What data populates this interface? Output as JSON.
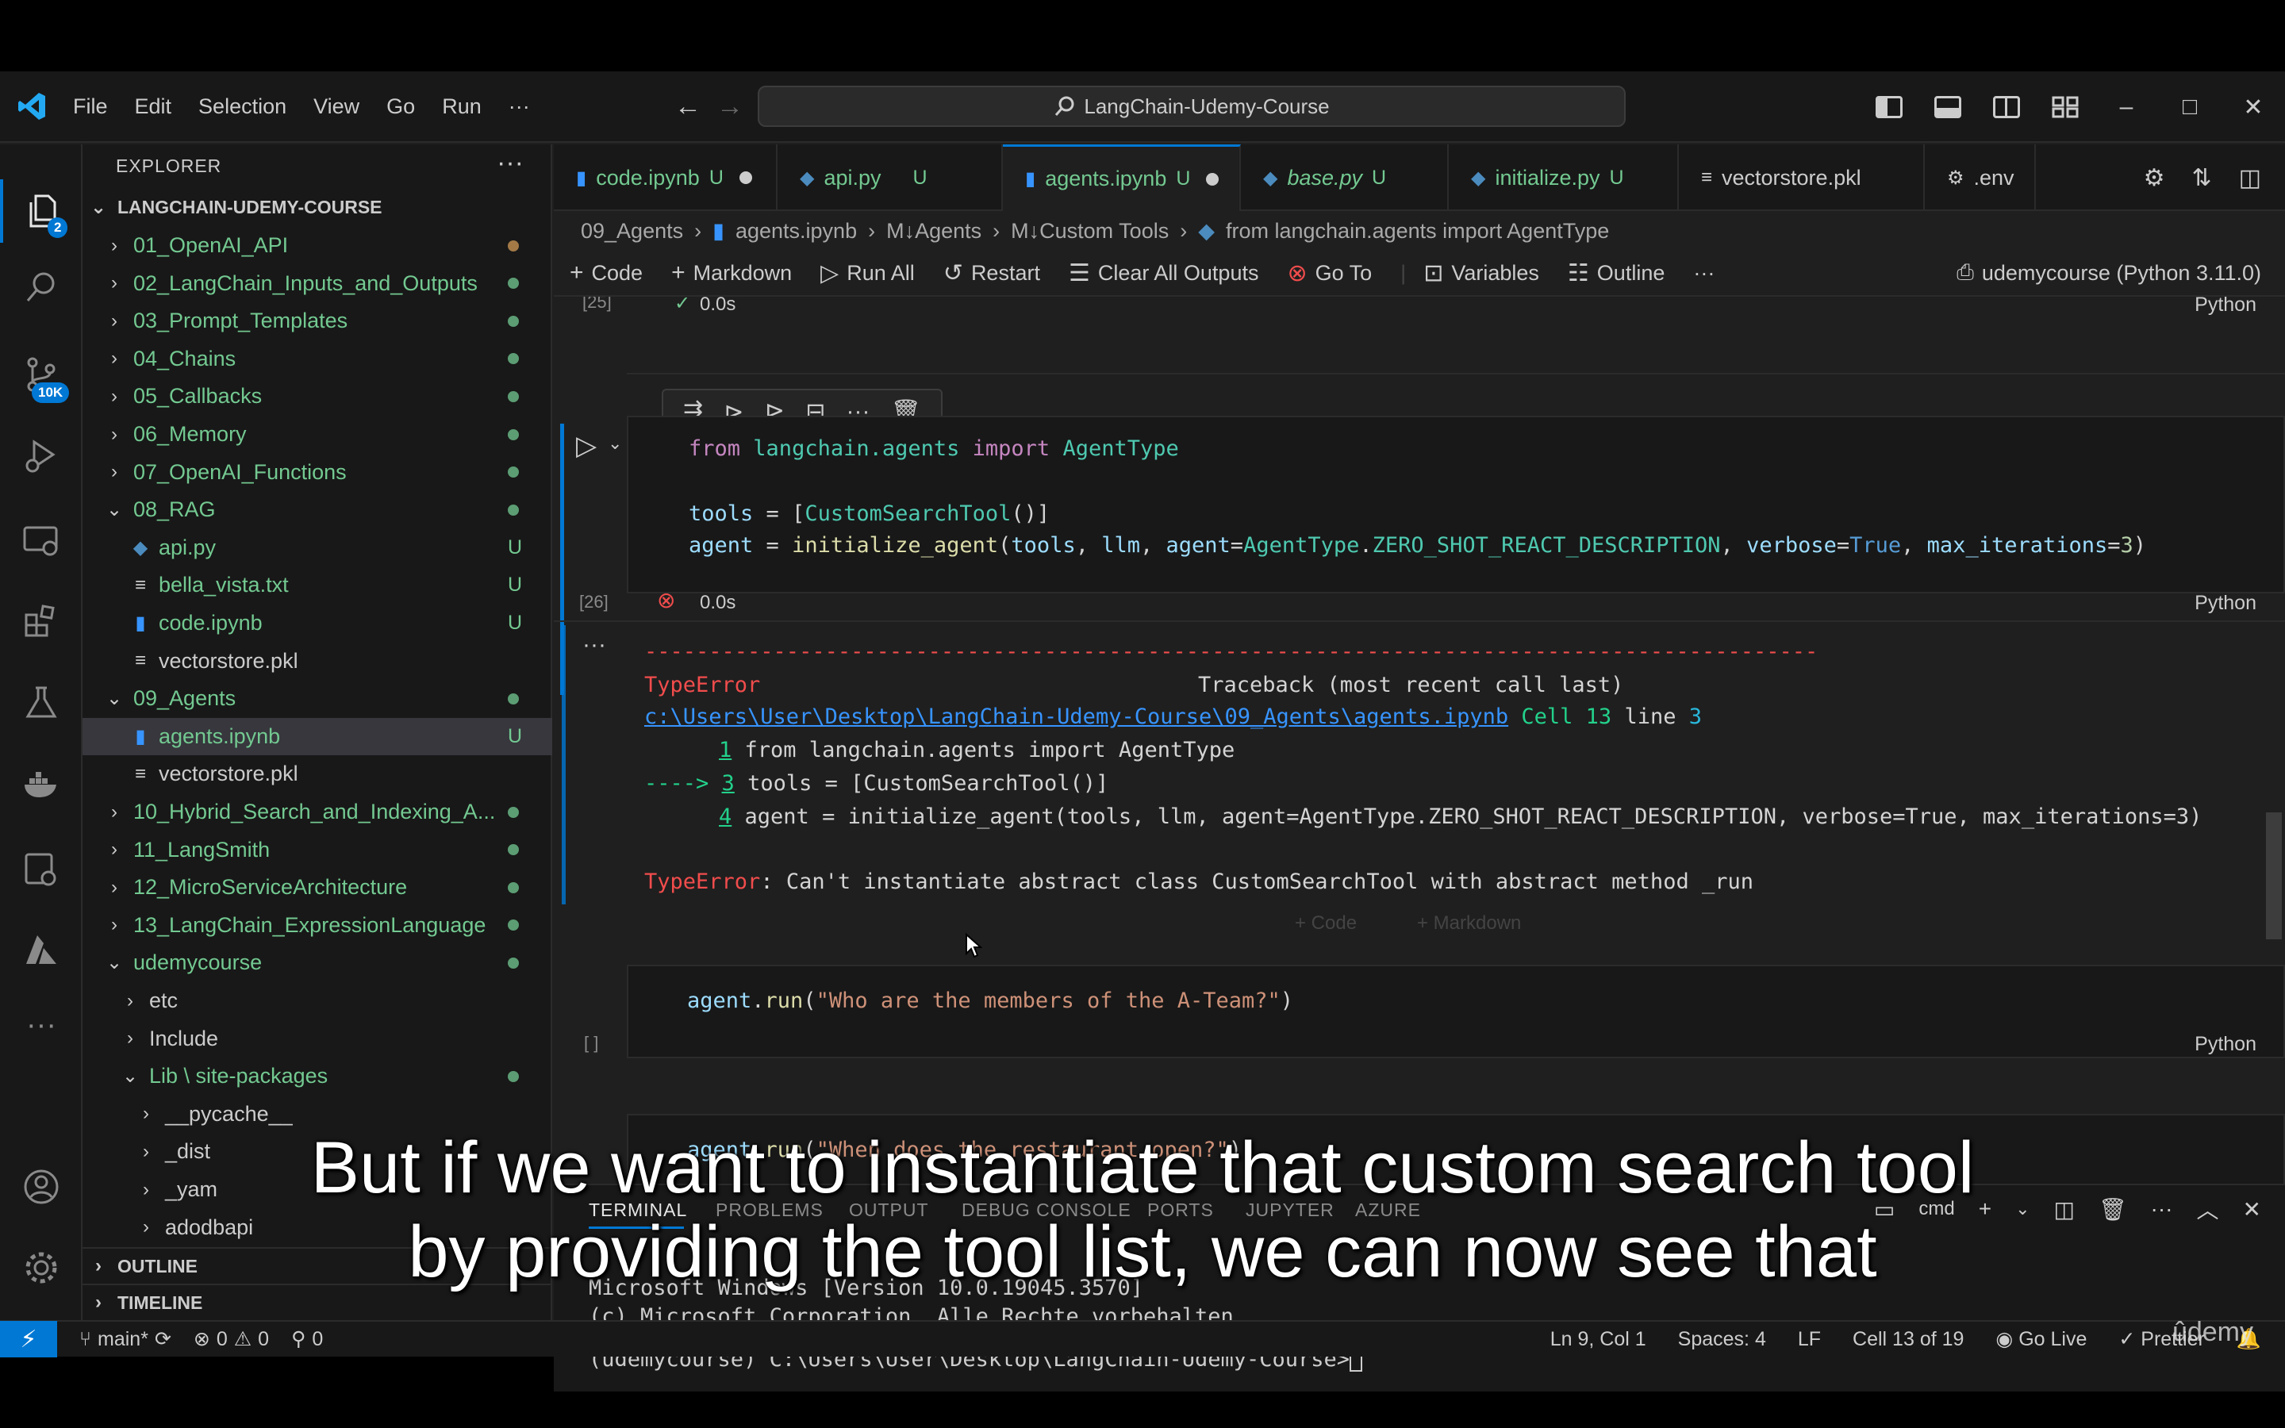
{
  "titlebar": {
    "menus": [
      "File",
      "Edit",
      "Selection",
      "View",
      "Go",
      "Run",
      "···"
    ],
    "search_text": "LangChain-Udemy-Course"
  },
  "activity": {
    "scm_badge": "10K",
    "explorer_badge": "2"
  },
  "sidebar": {
    "title": "EXPLORER",
    "more": "···",
    "root": "LANGCHAIN-UDEMY-COURSE",
    "tree": [
      {
        "label": "01_OpenAI_API",
        "chev": "›",
        "indent": 0,
        "status": "dot-orange",
        "color": "git"
      },
      {
        "label": "02_LangChain_Inputs_and_Outputs",
        "chev": "›",
        "indent": 0,
        "status": "dot",
        "color": "git"
      },
      {
        "label": "03_Prompt_Templates",
        "chev": "›",
        "indent": 0,
        "status": "dot",
        "color": "git"
      },
      {
        "label": "04_Chains",
        "chev": "›",
        "indent": 0,
        "status": "dot",
        "color": "git"
      },
      {
        "label": "05_Callbacks",
        "chev": "›",
        "indent": 0,
        "status": "dot",
        "color": "git"
      },
      {
        "label": "06_Memory",
        "chev": "›",
        "indent": 0,
        "status": "dot",
        "color": "git"
      },
      {
        "label": "07_OpenAI_Functions",
        "chev": "›",
        "indent": 0,
        "status": "dot",
        "color": "git"
      },
      {
        "label": "08_RAG",
        "chev": "⌄",
        "indent": 0,
        "status": "dot",
        "color": "git"
      },
      {
        "label": "api.py",
        "chev": "",
        "indent": 1,
        "status": "U",
        "color": "git",
        "icon": "py"
      },
      {
        "label": "bella_vista.txt",
        "chev": "",
        "indent": 1,
        "status": "U",
        "color": "git",
        "icon": "txt"
      },
      {
        "label": "code.ipynb",
        "chev": "",
        "indent": 1,
        "status": "U",
        "color": "git",
        "icon": "nb"
      },
      {
        "label": "vectorstore.pkl",
        "chev": "",
        "indent": 1,
        "status": "",
        "color": "plain",
        "icon": "txt"
      },
      {
        "label": "09_Agents",
        "chev": "⌄",
        "indent": 0,
        "status": "dot",
        "color": "git"
      },
      {
        "label": "agents.ipynb",
        "chev": "",
        "indent": 1,
        "status": "U",
        "color": "git",
        "icon": "nb",
        "selected": true
      },
      {
        "label": "vectorstore.pkl",
        "chev": "",
        "indent": 1,
        "status": "",
        "color": "plain",
        "icon": "txt"
      },
      {
        "label": "10_Hybrid_Search_and_Indexing_A...",
        "chev": "›",
        "indent": 0,
        "status": "dot",
        "color": "git"
      },
      {
        "label": "11_LangSmith",
        "chev": "›",
        "indent": 0,
        "status": "dot",
        "color": "git"
      },
      {
        "label": "12_MicroServiceArchitecture",
        "chev": "›",
        "indent": 0,
        "status": "dot",
        "color": "git"
      },
      {
        "label": "13_LangChain_ExpressionLanguage",
        "chev": "›",
        "indent": 0,
        "status": "dot",
        "color": "git"
      },
      {
        "label": "udemycourse",
        "chev": "⌄",
        "indent": 0,
        "status": "dot",
        "color": "git"
      },
      {
        "label": "etc",
        "chev": "›",
        "indent": 1,
        "status": "",
        "color": "plain"
      },
      {
        "label": "Include",
        "chev": "›",
        "indent": 1,
        "status": "",
        "color": "plain"
      },
      {
        "label": "Lib \\ site-packages",
        "chev": "⌄",
        "indent": 1,
        "status": "dot",
        "color": "git"
      },
      {
        "label": "__pycache__",
        "chev": "›",
        "indent": 2,
        "status": "",
        "color": "plain"
      },
      {
        "label": "_dist",
        "chev": "›",
        "indent": 2,
        "status": "",
        "color": "plain"
      },
      {
        "label": "_yam",
        "chev": "›",
        "indent": 2,
        "status": "",
        "color": "plain"
      },
      {
        "label": "adodbapi",
        "chev": "›",
        "indent": 2,
        "status": "",
        "color": "plain"
      }
    ],
    "outline": "OUTLINE",
    "timeline": "TIMELINE"
  },
  "tabs": [
    {
      "label": "code.ipynb",
      "flag": "U",
      "dirty": true,
      "icon": "nb"
    },
    {
      "label": "api.py",
      "flag": "U",
      "dirty": false,
      "icon": "py"
    },
    {
      "label": "agents.ipynb",
      "flag": "U",
      "dirty": true,
      "icon": "nb",
      "active": true
    },
    {
      "label": "base.py",
      "flag": "U",
      "dirty": false,
      "icon": "py",
      "italic": true
    },
    {
      "label": "initialize.py",
      "flag": "U",
      "dirty": false,
      "icon": "py"
    },
    {
      "label": "vectorstore.pkl",
      "flag": "",
      "dirty": false,
      "icon": "txt"
    },
    {
      "label": ".env",
      "flag": "",
      "dirty": false,
      "icon": "gear"
    }
  ],
  "breadcrumb": [
    "09_Agents",
    "agents.ipynb",
    "M↓Agents",
    "M↓Custom Tools",
    "from langchain.agents import AgentType"
  ],
  "nb_toolbar": {
    "code": "Code",
    "markdown": "Markdown",
    "run_all": "Run All",
    "restart": "Restart",
    "clear_outputs": "Clear All Outputs",
    "goto": "Go To",
    "variables": "Variables",
    "outline": "Outline",
    "more": "···",
    "kernel": "udemycourse (Python 3.11.0)"
  },
  "cells": {
    "prev_count": "[25]",
    "prev_time": "0.0s",
    "lang": "Python",
    "active_count": "[26]",
    "active_time": "0.0s",
    "active_code": [
      "from langchain.agents import AgentType",
      "",
      "tools = [CustomSearchTool()]",
      "agent = initialize_agent(tools, llm, agent=AgentType.ZERO_SHOT_REACT_DESCRIPTION, verbose=True, max_iterations=3)"
    ],
    "output": {
      "dashes": "-------------------------------------------------------------------------------------------",
      "error_name": "TypeError",
      "traceback": "Traceback (most recent call last)",
      "path": "c:\\Users\\User\\Desktop\\LangChain-Udemy-Course\\09_Agents\\agents.ipynb",
      "cell_ref": "Cell 13",
      "line_ref": "line 3",
      "line1_no": "1",
      "line1": "from langchain.agents import AgentType",
      "arrow": "---->",
      "line3_no": "3",
      "line3": "tools = [CustomSearchTool()]",
      "line4_no": "4",
      "line4": "agent = initialize_agent(tools, llm, agent=AgentType.ZERO_SHOT_REACT_DESCRIPTION, verbose=True, max_iterations=3)",
      "message": ": Can't instantiate abstract class CustomSearchTool with abstract method _run"
    },
    "add_code": "+ Code",
    "add_markdown": "+ Markdown",
    "next_count": "[ ]",
    "next_code_a": "agent.run(\"Who are the members of the A-Team?\")",
    "next_code_b": "agent.run(\"When does the restaurant open?\")"
  },
  "panel": {
    "tabs": [
      "TERMINAL",
      "PROBLEMS",
      "OUTPUT",
      "DEBUG CONSOLE",
      "PORTS",
      "JUPYTER",
      "AZURE"
    ],
    "shell": "cmd",
    "lines": [
      "Microsoft Windows [Version 10.0.19045.3570]",
      "(c) Microsoft Corporation. Alle Rechte vorbehalten.",
      "(udemycourse) C:\\Users\\User\\Desktop\\LangChain-Udemy-Course>"
    ]
  },
  "status": {
    "branch": "main*",
    "errors": "0",
    "warnings": "0",
    "ports": "0",
    "position": "Ln 9, Col 1",
    "spaces": "Spaces: 4",
    "eol": "LF",
    "cell": "Cell 13 of 19",
    "golive": "Go Live",
    "prettier": "Prettier"
  },
  "subtitles": [
    "But if we want to instantiate that custom search tool",
    "by providing the tool list, we can now see that"
  ],
  "watermark": "ûdemy",
  "colors": {
    "accent": "#0078d4",
    "git_added": "#73c991",
    "error": "#f14c4c"
  }
}
